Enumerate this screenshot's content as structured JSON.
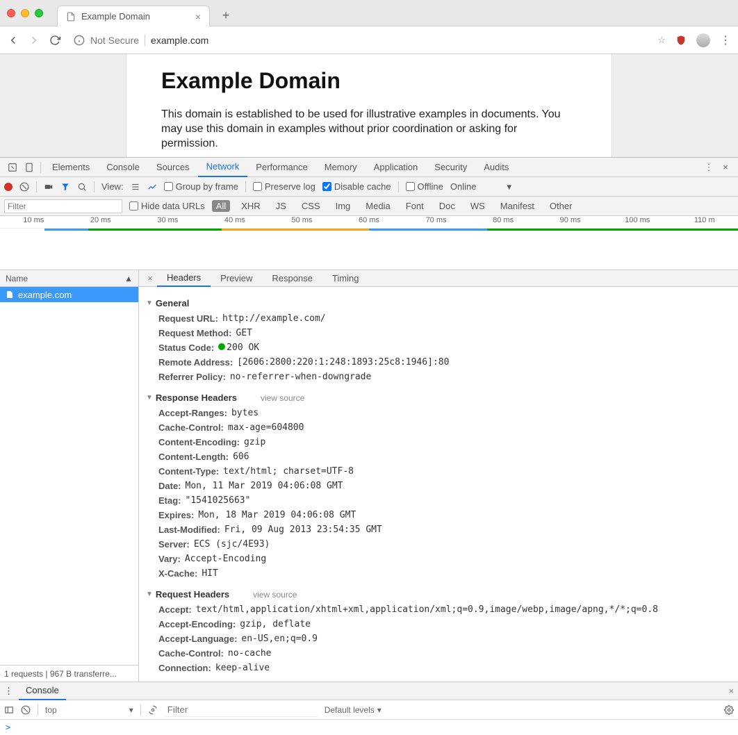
{
  "window": {
    "tab_title": "Example Domain"
  },
  "urlbar": {
    "security": "Not Secure",
    "url": "example.com"
  },
  "page": {
    "heading": "Example Domain",
    "paragraph": "This domain is established to be used for illustrative examples in documents. You may use this domain in examples without prior coordination or asking for permission."
  },
  "devtools": {
    "tabs": [
      "Elements",
      "Console",
      "Sources",
      "Network",
      "Performance",
      "Memory",
      "Application",
      "Security",
      "Audits"
    ],
    "active_tab": "Network",
    "toolbar": {
      "view_label": "View:",
      "group_by_frame": "Group by frame",
      "preserve_log": "Preserve log",
      "disable_cache": "Disable cache",
      "offline": "Offline",
      "throttle": "Online"
    },
    "filterbar": {
      "filter_placeholder": "Filter",
      "hide_data_urls": "Hide data URLs",
      "types": [
        "All",
        "XHR",
        "JS",
        "CSS",
        "Img",
        "Media",
        "Font",
        "Doc",
        "WS",
        "Manifest",
        "Other"
      ]
    },
    "timeline_labels": [
      "10 ms",
      "20 ms",
      "30 ms",
      "40 ms",
      "50 ms",
      "60 ms",
      "70 ms",
      "80 ms",
      "90 ms",
      "100 ms",
      "110 m"
    ]
  },
  "requests": {
    "name_header": "Name",
    "items": [
      "example.com"
    ],
    "footer": "1 requests | 967 B transferre..."
  },
  "detail": {
    "tabs": [
      "Headers",
      "Preview",
      "Response",
      "Timing"
    ],
    "general": {
      "title": "General",
      "request_url": {
        "k": "Request URL:",
        "v": "http://example.com/"
      },
      "request_method": {
        "k": "Request Method:",
        "v": "GET"
      },
      "status_code": {
        "k": "Status Code:",
        "v": "200 OK"
      },
      "remote_address": {
        "k": "Remote Address:",
        "v": "[2606:2800:220:1:248:1893:25c8:1946]:80"
      },
      "referrer_policy": {
        "k": "Referrer Policy:",
        "v": "no-referrer-when-downgrade"
      }
    },
    "response_headers": {
      "title": "Response Headers",
      "view_source": "view source",
      "rows": [
        {
          "k": "Accept-Ranges:",
          "v": "bytes"
        },
        {
          "k": "Cache-Control:",
          "v": "max-age=604800"
        },
        {
          "k": "Content-Encoding:",
          "v": "gzip"
        },
        {
          "k": "Content-Length:",
          "v": "606"
        },
        {
          "k": "Content-Type:",
          "v": "text/html; charset=UTF-8"
        },
        {
          "k": "Date:",
          "v": "Mon, 11 Mar 2019 04:06:08 GMT"
        },
        {
          "k": "Etag:",
          "v": "\"1541025663\""
        },
        {
          "k": "Expires:",
          "v": "Mon, 18 Mar 2019 04:06:08 GMT"
        },
        {
          "k": "Last-Modified:",
          "v": "Fri, 09 Aug 2013 23:54:35 GMT"
        },
        {
          "k": "Server:",
          "v": "ECS (sjc/4E93)"
        },
        {
          "k": "Vary:",
          "v": "Accept-Encoding"
        },
        {
          "k": "X-Cache:",
          "v": "HIT"
        }
      ]
    },
    "request_headers": {
      "title": "Request Headers",
      "view_source": "view source",
      "rows": [
        {
          "k": "Accept:",
          "v": "text/html,application/xhtml+xml,application/xml;q=0.9,image/webp,image/apng,*/*;q=0.8"
        },
        {
          "k": "Accept-Encoding:",
          "v": "gzip, deflate"
        },
        {
          "k": "Accept-Language:",
          "v": "en-US,en;q=0.9"
        },
        {
          "k": "Cache-Control:",
          "v": "no-cache"
        },
        {
          "k": "Connection:",
          "v": "keep-alive"
        }
      ]
    }
  },
  "console": {
    "tab": "Console",
    "context": "top",
    "filter_placeholder": "Filter",
    "levels": "Default levels",
    "prompt": ">"
  }
}
